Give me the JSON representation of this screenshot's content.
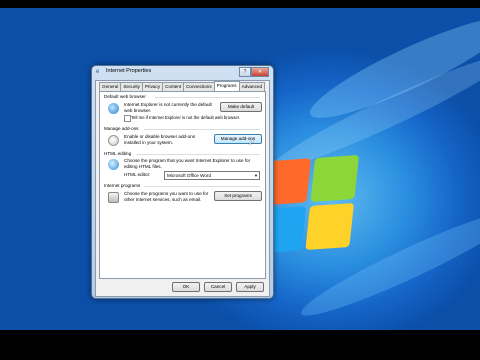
{
  "window": {
    "title": "Internet Properties"
  },
  "tabs": [
    "General",
    "Security",
    "Privacy",
    "Content",
    "Connections",
    "Programs",
    "Advanced"
  ],
  "default_browser": {
    "group": "Default web browser",
    "desc": "Internet Explorer is not currently the default web browser.",
    "button": "Make default",
    "checkbox": "Tell me if Internet Explorer is not the default web browser."
  },
  "addons": {
    "group": "Manage add-ons",
    "desc": "Enable or disable browser add-ons installed in your system.",
    "button": "Manage add-ons"
  },
  "html_editing": {
    "group": "HTML editing",
    "desc": "Choose the program that you want Internet Explorer to use for editing HTML files.",
    "label": "HTML editor:",
    "value": "Microsoft Office Word"
  },
  "programs": {
    "group": "Internet programs",
    "desc": "Choose the programs you want to use for other Internet services, such as email.",
    "button": "Set programs"
  },
  "footer": {
    "ok": "OK",
    "cancel": "Cancel",
    "apply": "Apply"
  },
  "icons": {
    "title": "ie-icon",
    "close": "close-icon"
  }
}
